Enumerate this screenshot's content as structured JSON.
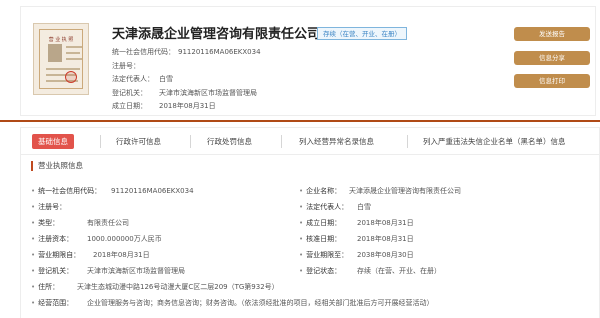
{
  "header": {
    "company_name": "天津添晟企业管理咨询有限责任公司",
    "status_badge": "存续（在营、开业、在册）",
    "license_title": "营 业 执 照",
    "fields": [
      {
        "label": "统一社会信用代码：",
        "value": "91120116MA06EKX034"
      },
      {
        "label": "注册号：",
        "value": ""
      },
      {
        "label": "法定代表人：",
        "value": "白雪"
      },
      {
        "label": "登记机关：",
        "value": "天津市滨海新区市场监督管理局"
      },
      {
        "label": "成立日期：",
        "value": "2018年08月31日"
      }
    ],
    "buttons": {
      "send_report": "发送报告",
      "share": "信息分享",
      "print": "信息打印"
    }
  },
  "tabs": [
    "基础信息",
    "行政许可信息",
    "行政处罚信息",
    "列入经营异常名录信息",
    "列入严重违法失信企业名单（黑名单）信息"
  ],
  "section_title": "营业执照信息",
  "details": {
    "credit_code_label": "统一社会信用代码：",
    "credit_code": "91120116MA06EKX034",
    "company_name_label": "企业名称：",
    "company_name": "天津添晟企业管理咨询有限责任公司",
    "reg_no_label": "注册号：",
    "reg_no": "",
    "legal_rep_label": "法定代表人：",
    "legal_rep": "白雪",
    "type_label": "类型：",
    "type": "有限责任公司",
    "established_label": "成立日期：",
    "established": "2018年08月31日",
    "capital_label": "注册资本：",
    "capital": "1000.000000万人民币",
    "approved_label": "核准日期：",
    "approved": "2018年08月31日",
    "term_from_label": "营业期限自：",
    "term_from": "2018年08月31日",
    "term_to_label": "营业期限至：",
    "term_to": "2038年08月30日",
    "authority_label": "登记机关：",
    "authority": "天津市滨海新区市场监督管理局",
    "status_label": "登记状态：",
    "status": "存续（在营、开业、在册）",
    "address_label": "住所：",
    "address": "天津生态城动漫中路126号动漫大厦C区二层209（TG第932号）",
    "scope_label": "经营范围：",
    "scope": "企业管理服务与咨询；商务信息咨询；财务咨询。（依法须经批准的项目，经相关部门批准后方可开展经营活动）"
  }
}
